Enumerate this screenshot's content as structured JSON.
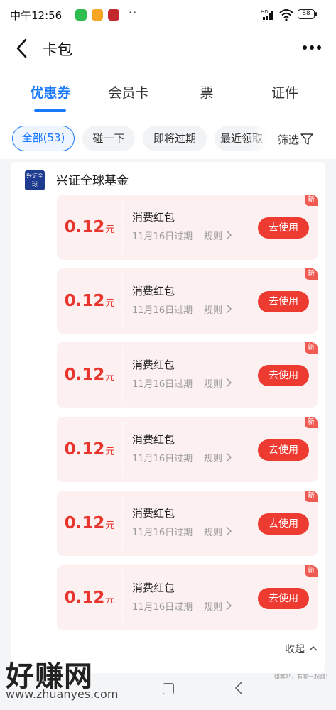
{
  "status_bar": {
    "time": "中午12:56",
    "dots": "··",
    "hd": "HD",
    "battery": "88"
  },
  "header": {
    "title": "卡包"
  },
  "tabs": [
    {
      "label": "优惠券",
      "active": true
    },
    {
      "label": "会员卡",
      "active": false
    },
    {
      "label": "票",
      "active": false
    },
    {
      "label": "证件",
      "active": false
    }
  ],
  "filters": {
    "chips": [
      "全部(53)",
      "碰一下",
      "即将过期",
      "最近领取"
    ],
    "filter_label": "筛选"
  },
  "merchant": {
    "name": "兴证全球基金",
    "logo_text": "兴证全球"
  },
  "coupons": [
    {
      "amount": "0.12",
      "unit": "元",
      "name": "消费红包",
      "expiry": "11月16日过期",
      "rules": "规则",
      "action": "去使用",
      "tag": "新"
    },
    {
      "amount": "0.12",
      "unit": "元",
      "name": "消费红包",
      "expiry": "11月16日过期",
      "rules": "规则",
      "action": "去使用",
      "tag": "新"
    },
    {
      "amount": "0.12",
      "unit": "元",
      "name": "消费红包",
      "expiry": "11月16日过期",
      "rules": "规则",
      "action": "去使用",
      "tag": "新"
    },
    {
      "amount": "0.12",
      "unit": "元",
      "name": "消费红包",
      "expiry": "11月16日过期",
      "rules": "规则",
      "action": "去使用",
      "tag": "新"
    },
    {
      "amount": "0.12",
      "unit": "元",
      "name": "消费红包",
      "expiry": "11月16日过期",
      "rules": "规则",
      "action": "去使用",
      "tag": "新"
    },
    {
      "amount": "0.12",
      "unit": "元",
      "name": "消费红包",
      "expiry": "11月16日过期",
      "rules": "规则",
      "action": "去使用",
      "tag": "新"
    }
  ],
  "collapse_label": "收起",
  "watermark": {
    "text": "好赚网",
    "url": "www.zhuanyes.com",
    "slogan": "赚客吧，有奖一起赚！"
  },
  "colors": {
    "accent": "#1677ff",
    "coupon_red": "#e8352d",
    "button_red": "#ee3b32",
    "coupon_bg": "#fdf0f0"
  }
}
